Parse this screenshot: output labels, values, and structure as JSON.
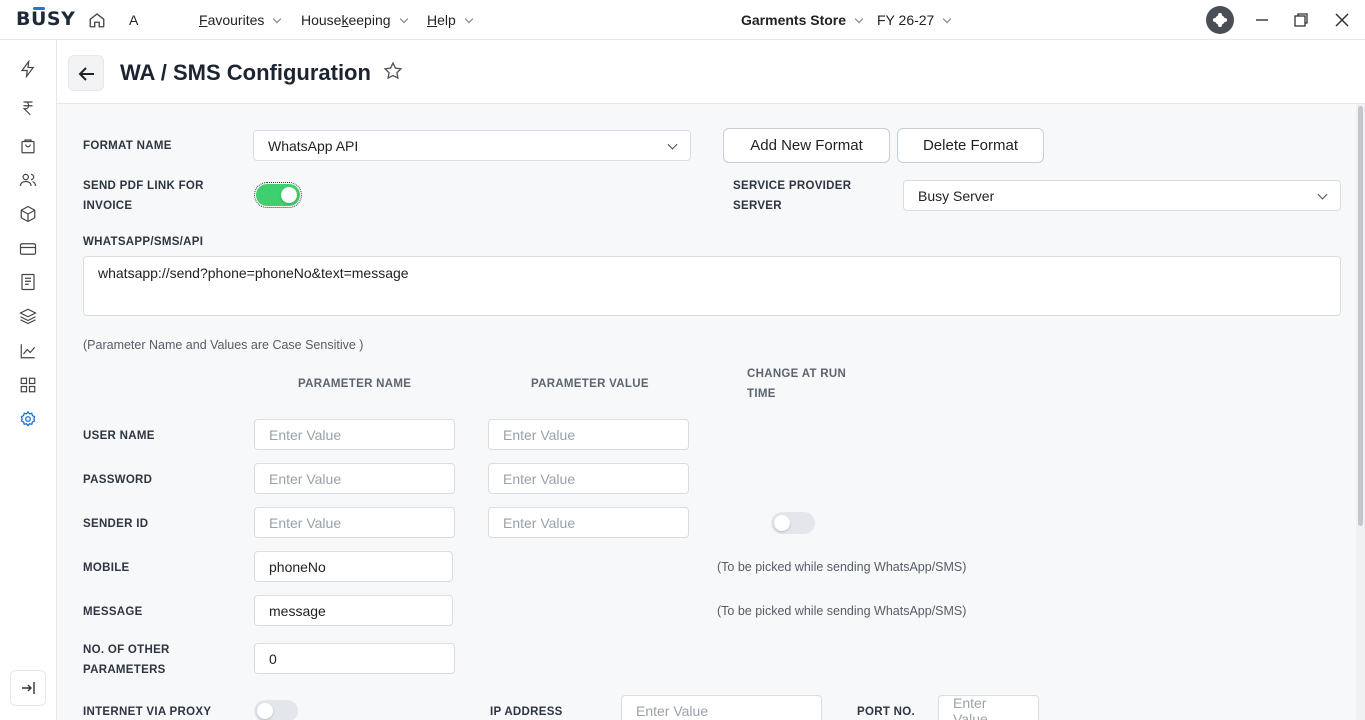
{
  "topbar": {
    "logo": "BUSY",
    "company_letter": "A",
    "menus": [
      {
        "label_pre": "",
        "label_ul": "F",
        "label_post": "avourites"
      },
      {
        "label_pre": "House",
        "label_ul": "k",
        "label_post": "eeping"
      },
      {
        "label_pre": "",
        "label_ul": "H",
        "label_post": "elp"
      }
    ],
    "store": "Garments Store",
    "fy": "FY 26-27"
  },
  "sidebar": {
    "icons": [
      "lightning-icon",
      "rupee-icon",
      "shopping-bag-icon",
      "users-icon",
      "box-icon",
      "card-icon",
      "document-icon",
      "layers-icon",
      "chart-icon",
      "grid-icon",
      "gear-icon"
    ],
    "active": "gear-icon"
  },
  "header": {
    "title": "WA / SMS Configuration"
  },
  "form": {
    "format_name_label": "FORMAT NAME",
    "format_name_value": "WhatsApp API",
    "add_format_label": "Add New Format",
    "delete_format_label": "Delete Format",
    "send_pdf_label_1": "SEND PDF LINK FOR",
    "send_pdf_label_2": "INVOICE",
    "send_pdf_enabled": true,
    "service_provider_label_1": "SERVICE PROVIDER",
    "service_provider_label_2": "SERVER",
    "service_provider_value": "Busy Server",
    "api_label": "WHATSAPP/SMS/API",
    "api_value": "whatsapp://send?phone=phoneNo&text=message",
    "case_note": "(Parameter Name and Values are Case Sensitive )",
    "col_param_name": "PARAMETER NAME",
    "col_param_value": "PARAMETER VALUE",
    "col_change_1": "CHANGE AT RUN",
    "col_change_2": "TIME",
    "placeholder": "Enter Value",
    "user_name_label": "USER NAME",
    "password_label": "PASSWORD",
    "sender_id_label": "SENDER ID",
    "sender_id_runtime": false,
    "mobile_label": "MOBILE",
    "mobile_value": "phoneNo",
    "mobile_note": "(To be picked while sending WhatsApp/SMS)",
    "message_label": "MESSAGE",
    "message_value": "message",
    "message_note": "(To be picked while sending WhatsApp/SMS)",
    "other_params_label_1": "NO. OF OTHER",
    "other_params_label_2": "PARAMETERS",
    "other_params_value": "0",
    "proxy_label": "INTERNET VIA PROXY",
    "proxy_enabled": false,
    "ip_label": "IP ADDRESS",
    "port_label": "PORT NO."
  }
}
